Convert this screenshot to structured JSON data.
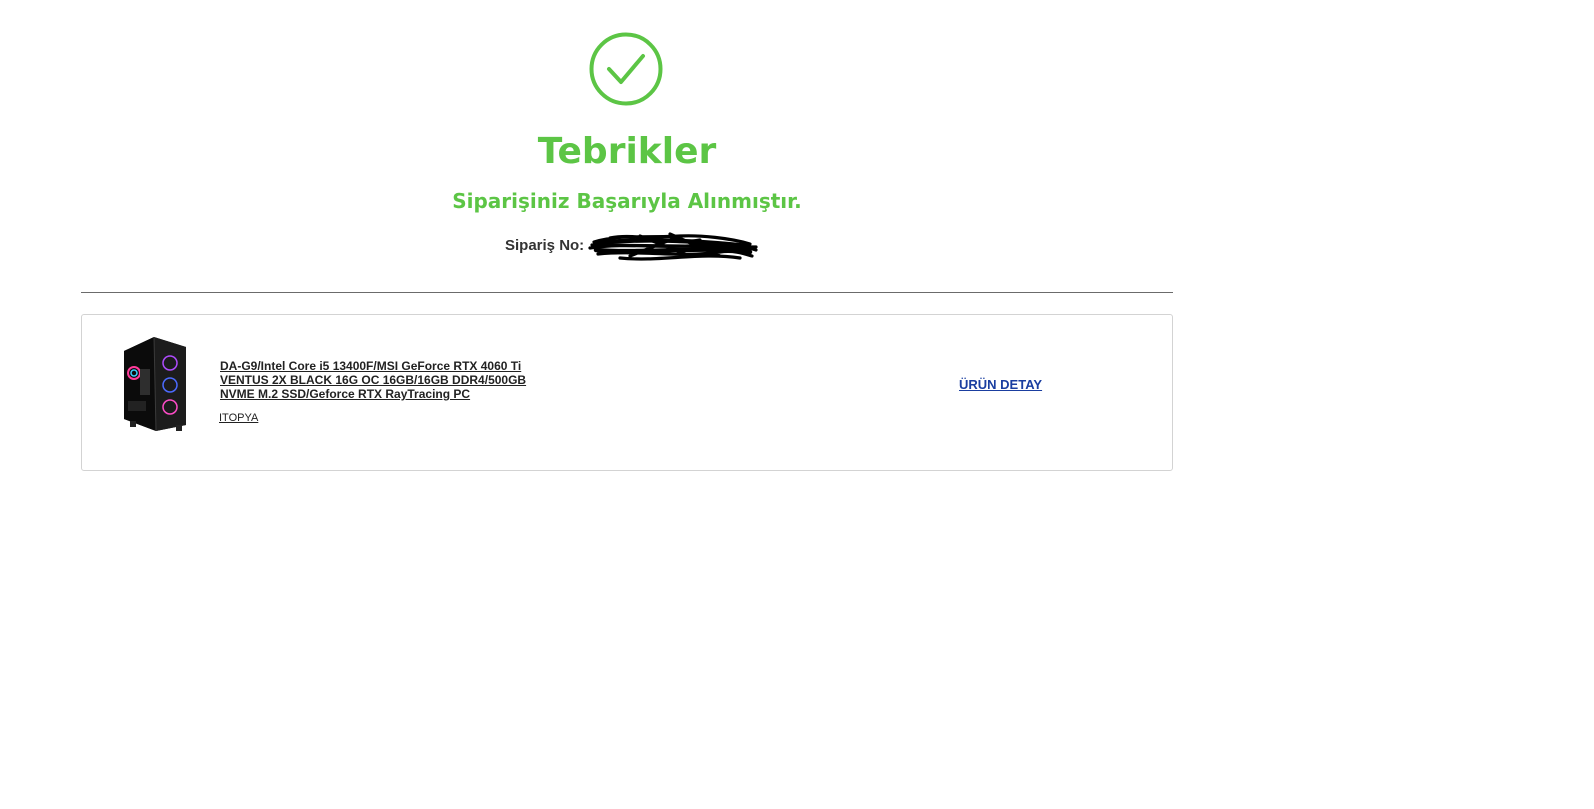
{
  "icons": {
    "success": "check-circle-icon",
    "success_color": "#5cc545"
  },
  "header": {
    "title": "Tebrikler",
    "subtitle": "Siparişiniz Başarıyla Alınmıştır.",
    "order_label": "Sipariş No:",
    "order_value": "",
    "accent_color": "#5cc545"
  },
  "order": {
    "items": [
      {
        "name": "DA-G9/Intel Core i5 13400F/MSI GeForce RTX 4060 Ti VENTUS 2X BLACK 16G OC 16GB/16GB DDR4/500GB NVME M.2 SSD/Geforce RTX RayTracing PC",
        "seller": "ITOPYA",
        "detail_label": "ÜRÜN DETAY",
        "detail_color": "#1a3ea0"
      }
    ]
  }
}
